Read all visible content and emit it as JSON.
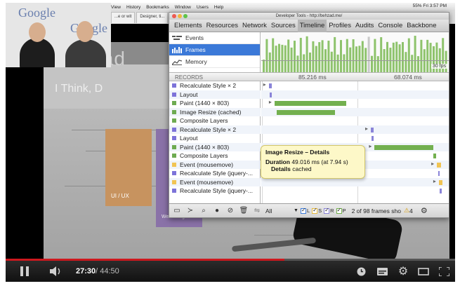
{
  "webcam": {
    "logo_text": "Google"
  },
  "site": {
    "heading": "Behzad",
    "subtitle": "I Think, D",
    "card1_label": "UI / UX",
    "card2_label": "Web design"
  },
  "mac_menu": {
    "items": [
      "View",
      "History",
      "Bookmarks",
      "Window",
      "Users",
      "Help"
    ],
    "status": "55% Fri 3:57 PM"
  },
  "browser_tabs": [
    "...e or wit",
    "Designer, ti..."
  ],
  "devtools": {
    "window_title": "Developer Tools - http://behzad.me/",
    "tabs": [
      "Elements",
      "Resources",
      "Network",
      "Sources",
      "Timeline",
      "Profiles",
      "Audits",
      "Console",
      "Backbone"
    ],
    "active_tab": "Timeline",
    "modes": [
      {
        "label": "Events",
        "active": false
      },
      {
        "label": "Frames",
        "active": true
      },
      {
        "label": "Memory",
        "active": false
      }
    ],
    "fps_label": "30 fps",
    "records_label": "RECORDS",
    "time_markers": [
      "85.216 ms",
      "68.074 ms"
    ],
    "records": [
      {
        "label": "Recalculate Style × 2",
        "color": "#7d73d9",
        "bar_color": "#8a84d8",
        "bar_start": 0.04,
        "bar_width": 0.015,
        "arrow": true
      },
      {
        "label": "Layout",
        "color": "#7d73d9",
        "bar_color": "#8a84d8",
        "bar_start": 0.045,
        "bar_width": 0.01,
        "arrow": false
      },
      {
        "label": "Paint (1440 × 803)",
        "color": "#6eab51",
        "bar_color": "#73b04f",
        "bar_start": 0.07,
        "bar_width": 0.38,
        "arrow": true
      },
      {
        "label": "Image Resize (cached)",
        "color": "#6eab51",
        "bar_color": "#73b04f",
        "bar_start": 0.08,
        "bar_width": 0.31,
        "arrow": false
      },
      {
        "label": "Composite Layers",
        "color": "#6eab51",
        "bar_color": "#73b04f",
        "bar_start": 0.0,
        "bar_width": 0.0,
        "arrow": false
      },
      {
        "label": "Recalculate Style × 2",
        "color": "#7d73d9",
        "bar_color": "#8a84d8",
        "bar_start": 0.58,
        "bar_width": 0.015,
        "arrow": true
      },
      {
        "label": "Layout",
        "color": "#7d73d9",
        "bar_color": "#8a84d8",
        "bar_start": 0.585,
        "bar_width": 0.01,
        "arrow": false
      },
      {
        "label": "Paint (1440 × 803)",
        "color": "#6eab51",
        "bar_color": "#73b04f",
        "bar_start": 0.6,
        "bar_width": 0.31,
        "arrow": true
      },
      {
        "label": "Composite Layers",
        "color": "#6eab51",
        "bar_color": "#73b04f",
        "bar_start": 0.91,
        "bar_width": 0.015,
        "arrow": false
      },
      {
        "label": "Event (mousemove)",
        "color": "#f1c453",
        "bar_color": "#f1c453",
        "bar_start": 0.93,
        "bar_width": 0.02,
        "arrow": true
      },
      {
        "label": "Recalculate Style (jquery-...",
        "color": "#7d73d9",
        "bar_color": "#8a84d8",
        "bar_start": 0.935,
        "bar_width": 0.01,
        "arrow": false
      },
      {
        "label": "Event (mousemove)",
        "color": "#f1c453",
        "bar_color": "#f1c453",
        "bar_start": 0.94,
        "bar_width": 0.02,
        "arrow": true
      },
      {
        "label": "Recalculate Style (jquery-...",
        "color": "#7d73d9",
        "bar_color": "#8a84d8",
        "bar_start": 0.945,
        "bar_width": 0.01,
        "arrow": false
      }
    ],
    "tooltip": {
      "title": "Image Resize – Details",
      "duration_label": "Duration",
      "duration_value": "49.016 ms (at 7.94 s)",
      "details_label": "Details",
      "details_value": "cached"
    },
    "status_bar": {
      "filter_value": "All",
      "checkbox_labels": [
        "L",
        "S",
        "R",
        "P"
      ],
      "frames_text": "2 of 98 frames sho",
      "warning_count": "4"
    }
  },
  "player": {
    "current_time": "27:30",
    "total_time": " / 44:50",
    "progress": 0.62
  },
  "colors": {
    "accent": "#3b79d8",
    "youtube_red": "#cc181e"
  }
}
